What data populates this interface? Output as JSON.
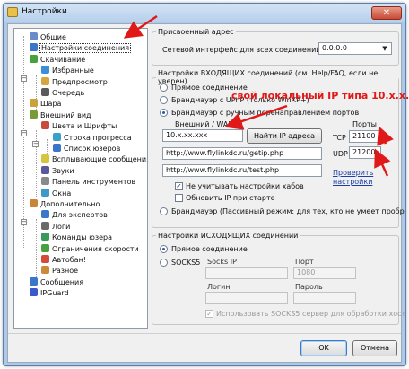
{
  "window": {
    "title": "Настройки",
    "close_glyph": "✕"
  },
  "tree": {
    "items": [
      {
        "label": "Общие",
        "icon": "general-icon",
        "color": "#6a8dc9"
      },
      {
        "label": "Настройки соединения",
        "icon": "connection-icon",
        "color": "#3a76c9",
        "selected": true
      },
      {
        "label": "Скачивание",
        "icon": "download-icon",
        "color": "#48a13c"
      },
      {
        "label": "Избранные",
        "icon": "favorites-icon",
        "color": "#3c8fd6"
      },
      {
        "label": "Предпросмотр",
        "icon": "preview-icon",
        "color": "#d6a53c"
      },
      {
        "label": "Очередь",
        "icon": "queue-icon",
        "color": "#5a5a5a"
      },
      {
        "label": "Шара",
        "icon": "share-icon",
        "color": "#c9a33a"
      },
      {
        "label": "Внешний вид",
        "icon": "appearance-icon",
        "color": "#7a9a3a"
      },
      {
        "label": "Цвета и Шрифты",
        "icon": "colors-icon",
        "color": "#c94a3a"
      },
      {
        "label": "Строка прогресса",
        "icon": "progress-icon",
        "color": "#3aa0c9"
      },
      {
        "label": "Список юзеров",
        "icon": "users-icon",
        "color": "#3a76c9"
      },
      {
        "label": "Всплывающие сообщения",
        "icon": "popups-icon",
        "color": "#d6c43c"
      },
      {
        "label": "Звуки",
        "icon": "sounds-icon",
        "color": "#5a5a9a"
      },
      {
        "label": "Панель инструментов",
        "icon": "toolbar-icon",
        "color": "#8a8a8a"
      },
      {
        "label": "Окна",
        "icon": "windows-icon",
        "color": "#3a9ac9"
      },
      {
        "label": "Дополнительно",
        "icon": "advanced-icon",
        "color": "#c9853a"
      },
      {
        "label": "Для экспертов",
        "icon": "experts-icon",
        "color": "#3a76c9"
      },
      {
        "label": "Логи",
        "icon": "logs-icon",
        "color": "#6a6a6a"
      },
      {
        "label": "Команды юзера",
        "icon": "user-commands-icon",
        "color": "#3a9a5a"
      },
      {
        "label": "Ограничения скорости",
        "icon": "speed-limit-icon",
        "color": "#48a13c"
      },
      {
        "label": "Автобан!",
        "icon": "autoban-icon",
        "color": "#d64a3a"
      },
      {
        "label": "Разное",
        "icon": "misc-icon",
        "color": "#c98a3a"
      },
      {
        "label": "Сообщения",
        "icon": "messages-icon",
        "color": "#3a76c9"
      },
      {
        "label": "IPGuard",
        "icon": "ipguard-icon",
        "color": "#3a5ac9"
      }
    ]
  },
  "bind": {
    "legend": "Присвоенный адрес",
    "label": "Сетевой интерфейс для всех соединений",
    "value": "0.0.0.0"
  },
  "incoming": {
    "legend": "Настройки ВХОДЯЩИХ соединений (см. Help/FAQ, если не уверен)",
    "opt_direct": "Прямое соединение",
    "opt_upnp": "Брандмауэр с UPnP (только WinXP+)",
    "opt_manual": "Брандмауэр с ручным перенаправлением портов",
    "wan_label": "Внешний / WAN IP",
    "wan_value": "10.x.xx.xxx",
    "find_ip_button": "Найти IP адреса",
    "url1": "http://www.flylinkdc.ru/getip.php",
    "url2": "http://www.flylinkdc.ru/test.php",
    "chk_ignore_hub": "Не учитывать настройки хабов",
    "chk_update_ip": "Обновить IP при старте",
    "opt_passive": "Брандмауэр (Пассивный режим: для тех, кто не умеет пробрасывать",
    "ports_label": "Порты",
    "tcp_label": "TCP",
    "tcp_value": "21100",
    "udp_label": "UDP",
    "udp_value": "21200",
    "check_settings_link": "Проверить настройки"
  },
  "outgoing": {
    "legend": "Настройки ИСХОДЯЩИХ соединений",
    "opt_direct": "Прямое соединение",
    "opt_socks5": "SOCKS5",
    "socks_ip_label": "Socks IP",
    "port_label": "Порт",
    "port_value": "1080",
    "login_label": "Логин",
    "password_label": "Пароль",
    "chk_socks_hosts": "Использовать SOCKS5 сервер для обработки хостов"
  },
  "annotation": {
    "text": "свой локальный IP типа 10.x.x.x",
    "color": "#e01818"
  },
  "buttons": {
    "ok": "OK",
    "cancel": "Отмена"
  }
}
